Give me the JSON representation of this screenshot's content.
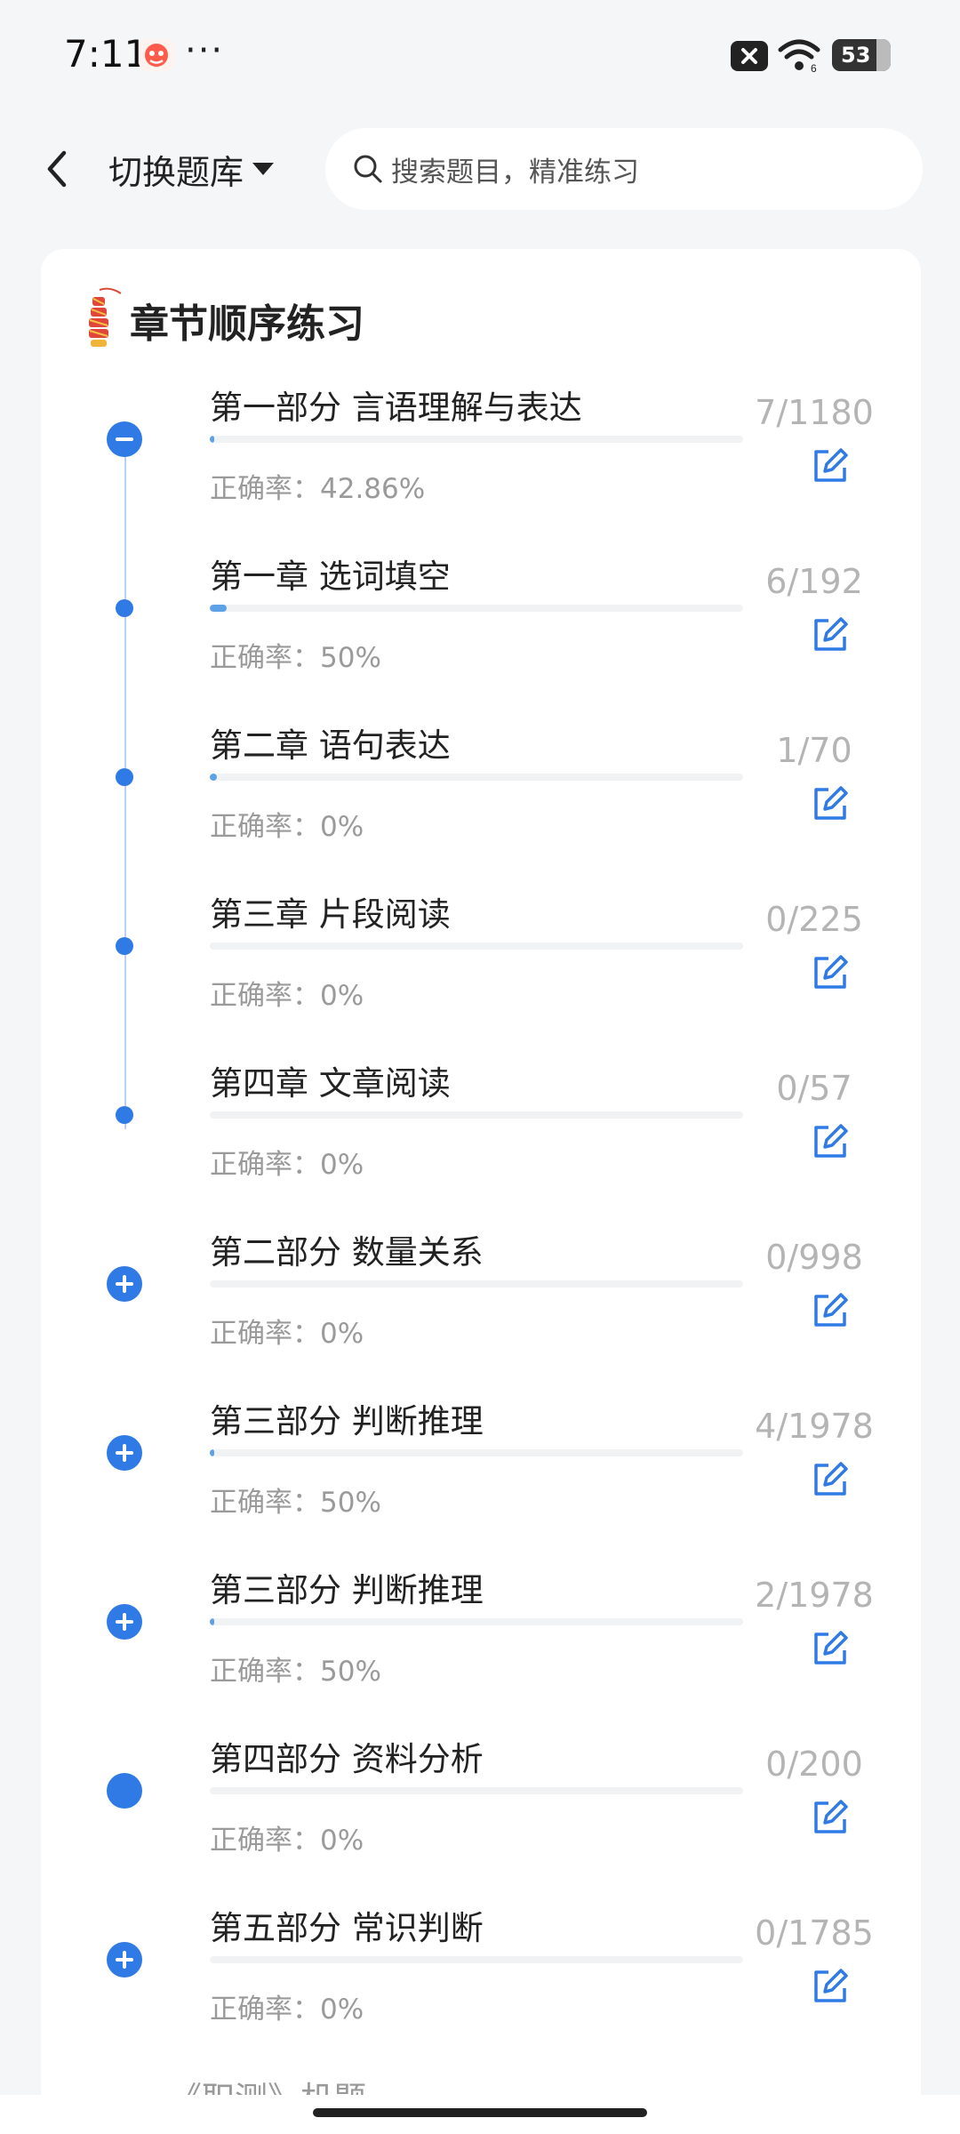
{
  "status_bar": {
    "time": "7:11",
    "more": "···",
    "battery": "53",
    "icons": [
      "app-notification-icon",
      "close-box-icon",
      "wifi-icon",
      "battery-icon"
    ]
  },
  "header": {
    "back_icon": "chevron-left-icon",
    "switch_label": "切换题库",
    "search_placeholder": "搜索题目，精准练习"
  },
  "section": {
    "title": "章节顺序练习",
    "icon": "firecracker-icon"
  },
  "colors": {
    "accent": "#2f7ae5",
    "progress": "#5da2e6",
    "muted_text": "#9a9a9a"
  },
  "items": [
    {
      "title": "第一部分 言语理解与表达",
      "accuracy": "正确率：42.86%",
      "count": "7/1180",
      "progress": 0.006,
      "marker": "minus"
    },
    {
      "title": "第一章 选词填空",
      "accuracy": "正确率：50%",
      "count": "6/192",
      "progress": 0.031,
      "marker": "dot"
    },
    {
      "title": "第二章 语句表达",
      "accuracy": "正确率：0%",
      "count": "1/70",
      "progress": 0.014,
      "marker": "dot"
    },
    {
      "title": "第三章 片段阅读",
      "accuracy": "正确率：0%",
      "count": "0/225",
      "progress": 0,
      "marker": "dot"
    },
    {
      "title": "第四章 文章阅读",
      "accuracy": "正确率：0%",
      "count": "0/57",
      "progress": 0,
      "marker": "dot"
    },
    {
      "title": "第二部分 数量关系",
      "accuracy": "正确率：0%",
      "count": "0/998",
      "progress": 0,
      "marker": "plus"
    },
    {
      "title": "第三部分 判断推理",
      "accuracy": "正确率：50%",
      "count": "4/1978",
      "progress": 0.002,
      "marker": "plus"
    },
    {
      "title": "第三部分 判断推理",
      "accuracy": "正确率：50%",
      "count": "2/1978",
      "progress": 0.001,
      "marker": "plus"
    },
    {
      "title": "第四部分 资料分析",
      "accuracy": "正确率：0%",
      "count": "0/200",
      "progress": 0,
      "marker": "filled"
    },
    {
      "title": "第五部分 常识判断",
      "accuracy": "正确率：0%",
      "count": "0/1785",
      "progress": 0,
      "marker": "plus"
    }
  ],
  "next_item_partial": "《职测》机题"
}
